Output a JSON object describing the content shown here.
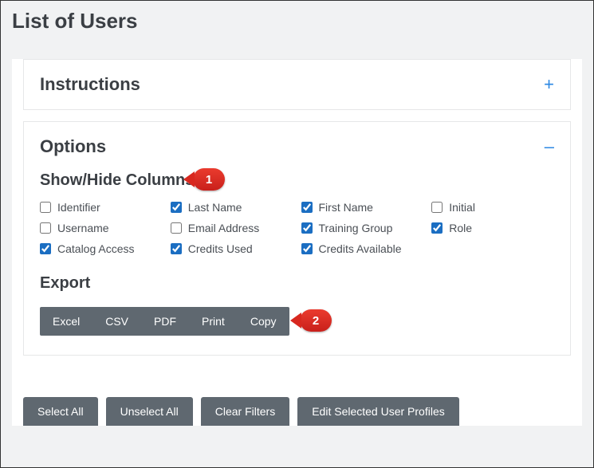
{
  "page": {
    "title": "List of Users"
  },
  "instructions": {
    "title": "Instructions",
    "toggle_icon": "+"
  },
  "options": {
    "title": "Options",
    "toggle_icon": "–",
    "showhide": {
      "title": "Show/Hide Columns",
      "columns": [
        {
          "label": "Identifier",
          "checked": false
        },
        {
          "label": "Last Name",
          "checked": true
        },
        {
          "label": "First Name",
          "checked": true
        },
        {
          "label": "Initial",
          "checked": false
        },
        {
          "label": "Username",
          "checked": false
        },
        {
          "label": "Email Address",
          "checked": false
        },
        {
          "label": "Training Group",
          "checked": true
        },
        {
          "label": "Role",
          "checked": true
        },
        {
          "label": "Catalog Access",
          "checked": true
        },
        {
          "label": "Credits Used",
          "checked": true
        },
        {
          "label": "Credits Available",
          "checked": true
        }
      ]
    },
    "export": {
      "title": "Export",
      "buttons": [
        "Excel",
        "CSV",
        "PDF",
        "Print",
        "Copy"
      ]
    }
  },
  "actions": {
    "select_all": "Select All",
    "unselect_all": "Unselect All",
    "clear_filters": "Clear Filters",
    "edit_profiles": "Edit Selected User Profiles"
  },
  "markers": {
    "m1": "1",
    "m2": "2"
  }
}
